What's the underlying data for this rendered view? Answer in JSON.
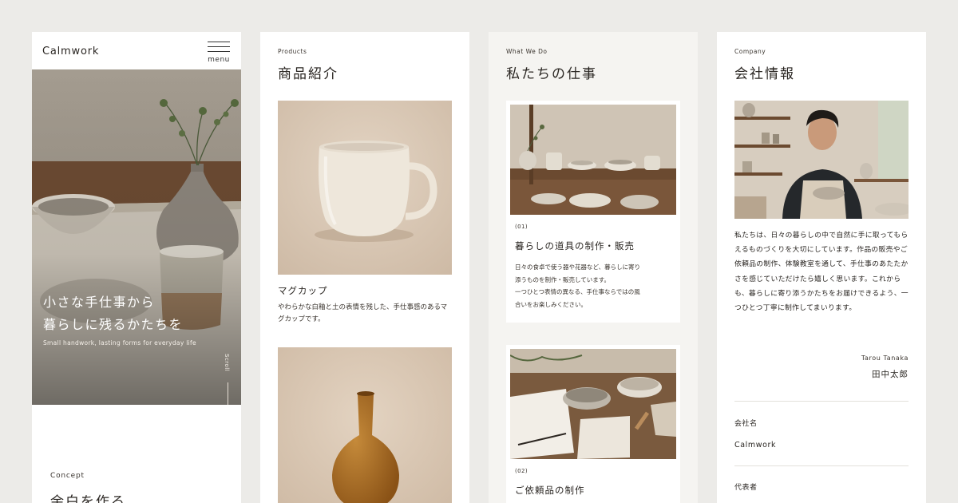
{
  "colors": {
    "background": "#ecebe8",
    "panel": "#ffffff",
    "panel_alt": "#f5f4f1",
    "text": "#2a2622"
  },
  "home": {
    "brand": "Calmwork",
    "menu_label": "menu",
    "hero_title": "小さな手仕事から\n暮らしに残るかたちを",
    "hero_subtitle": "Small handwork, lasting forms for everyday life",
    "scroll_label": "Scroll",
    "concept_label": "Concept",
    "concept_title": "余白を作る"
  },
  "products": {
    "label": "Products",
    "title": "商品紹介",
    "items": [
      {
        "name": "マグカップ",
        "description": "やわらかな白釉と土の表情を残した、手仕事感のあるマグカップです。"
      },
      {
        "name": "",
        "description": ""
      }
    ]
  },
  "what_we_do": {
    "label": "What We Do",
    "title": "私たちの仕事",
    "cards": [
      {
        "number": "(01)",
        "title": "暮らしの道具の制作・販売",
        "description": "日々の食卓で使う器や花器など、暮らしに寄り\n添うものを制作・販売しています。\n一つひとつ表情の異なる、手仕事ならではの風\n合いをお楽しみください。"
      },
      {
        "number": "(02)",
        "title": "ご依頼品の制作",
        "description": ""
      }
    ]
  },
  "company": {
    "label": "Company",
    "title": "会社情報",
    "message": "私たちは、日々の暮らしの中で自然に手に取ってもらえるものづくりを大切にしています。作品の販売やご依頼品の制作、体験教室を通して、手仕事のあたたかさを感じていただけたら嬉しく思います。これからも、暮らしに寄り添うかたちをお届けできるよう、一つひとつ丁寧に制作してまいります。",
    "signature_en": "Tarou Tanaka",
    "signature_jp": "田中太郎",
    "info": [
      {
        "label": "会社名",
        "value": "Calmwork"
      },
      {
        "label": "代表者",
        "value": ""
      }
    ]
  }
}
